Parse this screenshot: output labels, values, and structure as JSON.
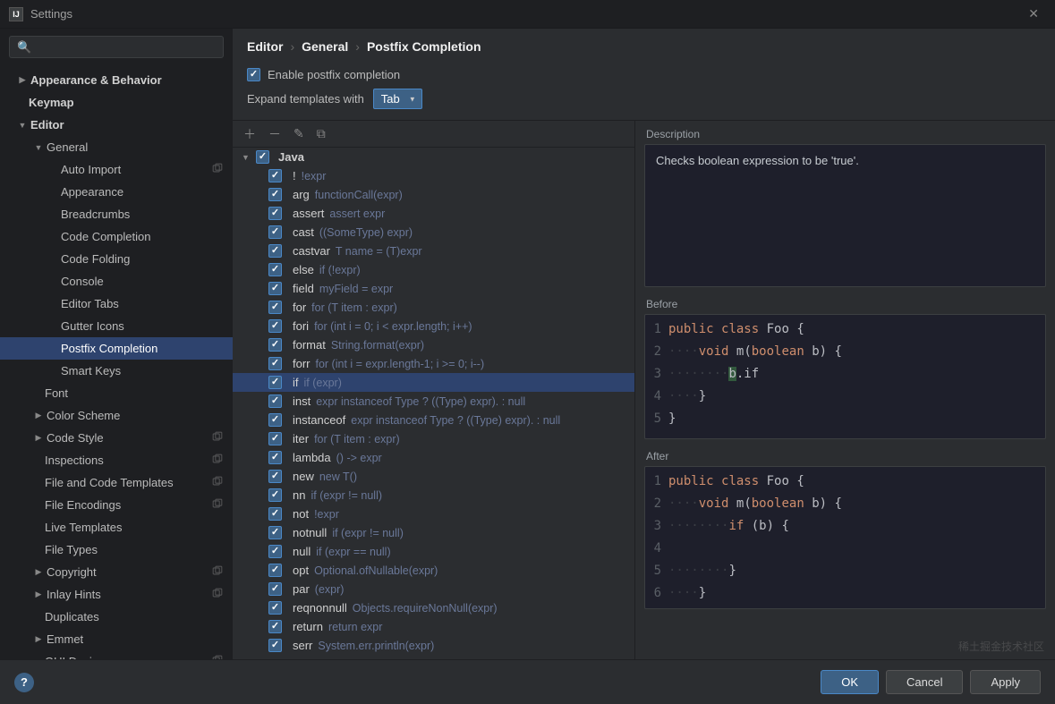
{
  "title": "Settings",
  "breadcrumb": [
    "Editor",
    "General",
    "Postfix Completion"
  ],
  "enable_label": "Enable postfix completion",
  "expand_label": "Expand templates with",
  "expand_value": "Tab",
  "sidebar": [
    {
      "label": "Appearance & Behavior",
      "depth": 0,
      "arrow": "▶",
      "bold": true
    },
    {
      "label": "Keymap",
      "depth": 0,
      "bold": true
    },
    {
      "label": "Editor",
      "depth": 0,
      "arrow": "▼",
      "bold": true
    },
    {
      "label": "General",
      "depth": 1,
      "arrow": "▼"
    },
    {
      "label": "Auto Import",
      "depth": 2,
      "badge": true
    },
    {
      "label": "Appearance",
      "depth": 2
    },
    {
      "label": "Breadcrumbs",
      "depth": 2
    },
    {
      "label": "Code Completion",
      "depth": 2
    },
    {
      "label": "Code Folding",
      "depth": 2
    },
    {
      "label": "Console",
      "depth": 2
    },
    {
      "label": "Editor Tabs",
      "depth": 2
    },
    {
      "label": "Gutter Icons",
      "depth": 2
    },
    {
      "label": "Postfix Completion",
      "depth": 2,
      "selected": true
    },
    {
      "label": "Smart Keys",
      "depth": 2
    },
    {
      "label": "Font",
      "depth": 1
    },
    {
      "label": "Color Scheme",
      "depth": 1,
      "arrow": "▶"
    },
    {
      "label": "Code Style",
      "depth": 1,
      "arrow": "▶",
      "badge": true
    },
    {
      "label": "Inspections",
      "depth": 1,
      "badge": true
    },
    {
      "label": "File and Code Templates",
      "depth": 1,
      "badge": true
    },
    {
      "label": "File Encodings",
      "depth": 1,
      "badge": true
    },
    {
      "label": "Live Templates",
      "depth": 1
    },
    {
      "label": "File Types",
      "depth": 1
    },
    {
      "label": "Copyright",
      "depth": 1,
      "arrow": "▶",
      "badge": true
    },
    {
      "label": "Inlay Hints",
      "depth": 1,
      "arrow": "▶",
      "badge": true
    },
    {
      "label": "Duplicates",
      "depth": 1
    },
    {
      "label": "Emmet",
      "depth": 1,
      "arrow": "▶"
    },
    {
      "label": "GUI Designer",
      "depth": 1,
      "badge": true
    }
  ],
  "postfix": {
    "group": "Java",
    "items": [
      {
        "key": "!",
        "hint": "!expr"
      },
      {
        "key": "arg",
        "hint": "functionCall(expr)"
      },
      {
        "key": "assert",
        "hint": "assert expr"
      },
      {
        "key": "cast",
        "hint": "((SomeType) expr)"
      },
      {
        "key": "castvar",
        "hint": "T name = (T)expr"
      },
      {
        "key": "else",
        "hint": "if (!expr)"
      },
      {
        "key": "field",
        "hint": "myField = expr"
      },
      {
        "key": "for",
        "hint": "for (T item : expr)"
      },
      {
        "key": "fori",
        "hint": "for (int i = 0; i < expr.length; i++)"
      },
      {
        "key": "format",
        "hint": "String.format(expr)"
      },
      {
        "key": "forr",
        "hint": "for (int i = expr.length-1; i >= 0; i--)"
      },
      {
        "key": "if",
        "hint": "if (expr)",
        "selected": true
      },
      {
        "key": "inst",
        "hint": "expr instanceof Type ? ((Type) expr). : null"
      },
      {
        "key": "instanceof",
        "hint": "expr instanceof Type ? ((Type) expr). : null"
      },
      {
        "key": "iter",
        "hint": "for (T item : expr)"
      },
      {
        "key": "lambda",
        "hint": "() -> expr"
      },
      {
        "key": "new",
        "hint": "new T()"
      },
      {
        "key": "nn",
        "hint": "if (expr != null)"
      },
      {
        "key": "not",
        "hint": "!expr"
      },
      {
        "key": "notnull",
        "hint": "if (expr != null)"
      },
      {
        "key": "null",
        "hint": "if (expr == null)"
      },
      {
        "key": "opt",
        "hint": "Optional.ofNullable(expr)"
      },
      {
        "key": "par",
        "hint": "(expr)"
      },
      {
        "key": "reqnonnull",
        "hint": "Objects.requireNonNull(expr)"
      },
      {
        "key": "return",
        "hint": "return expr"
      },
      {
        "key": "serr",
        "hint": "System.err.println(expr)"
      }
    ]
  },
  "description_label": "Description",
  "description": "Checks boolean expression to be 'true'.",
  "before_label": "Before",
  "after_label": "After",
  "buttons": {
    "ok": "OK",
    "cancel": "Cancel",
    "apply": "Apply"
  },
  "watermark": "稀土掘金技术社区"
}
